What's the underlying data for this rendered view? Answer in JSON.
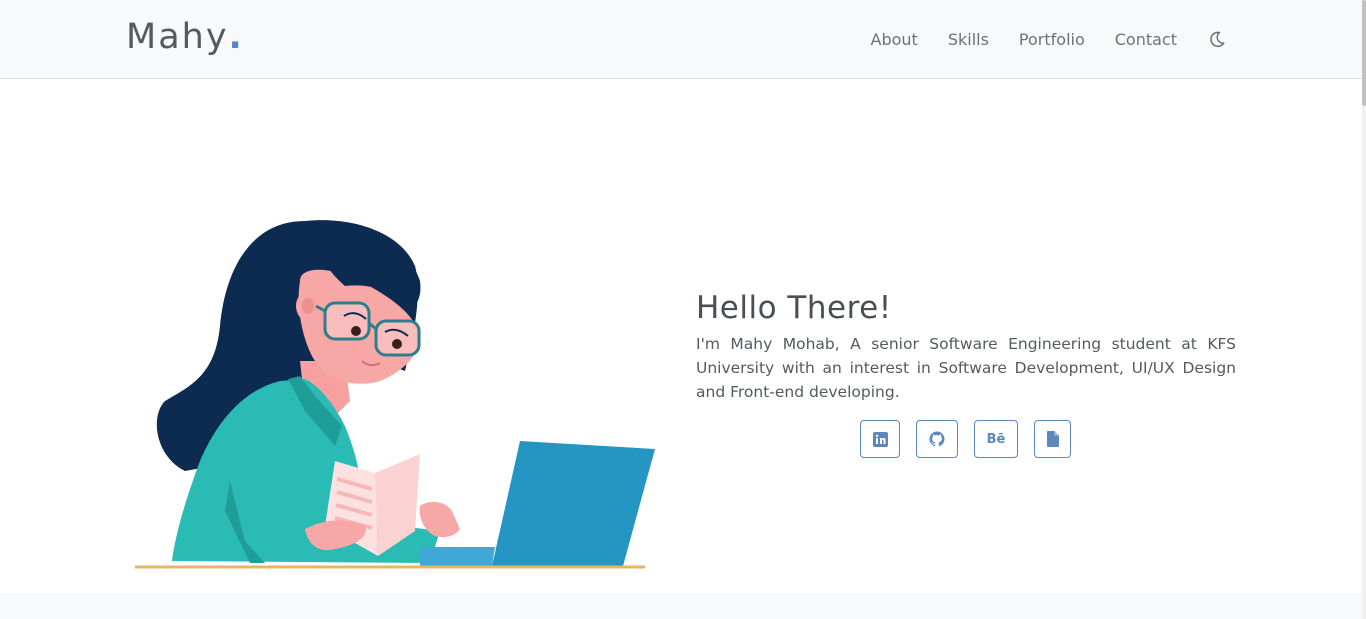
{
  "navbar": {
    "brand": "Mahy",
    "brand_dot": ".",
    "links": [
      {
        "label": "About"
      },
      {
        "label": "Skills"
      },
      {
        "label": "Portfolio"
      },
      {
        "label": "Contact"
      }
    ],
    "theme_icon": "moon-icon"
  },
  "hero": {
    "title": "Hello There!",
    "description": "I'm Mahy Mohab, A senior Software Engineering student at KFS University with an interest in Software Development, UI/UX Design and Front-end developing.",
    "illustration": "woman-reading-at-laptop-illustration",
    "social": [
      {
        "icon": "linkedin-icon"
      },
      {
        "icon": "github-icon"
      },
      {
        "icon": "behance-icon",
        "text": "Bē"
      },
      {
        "icon": "document-icon"
      }
    ]
  },
  "colors": {
    "accent": "#5e87bd",
    "navbar_bg": "#f8f9fa",
    "text": "#555a60"
  }
}
